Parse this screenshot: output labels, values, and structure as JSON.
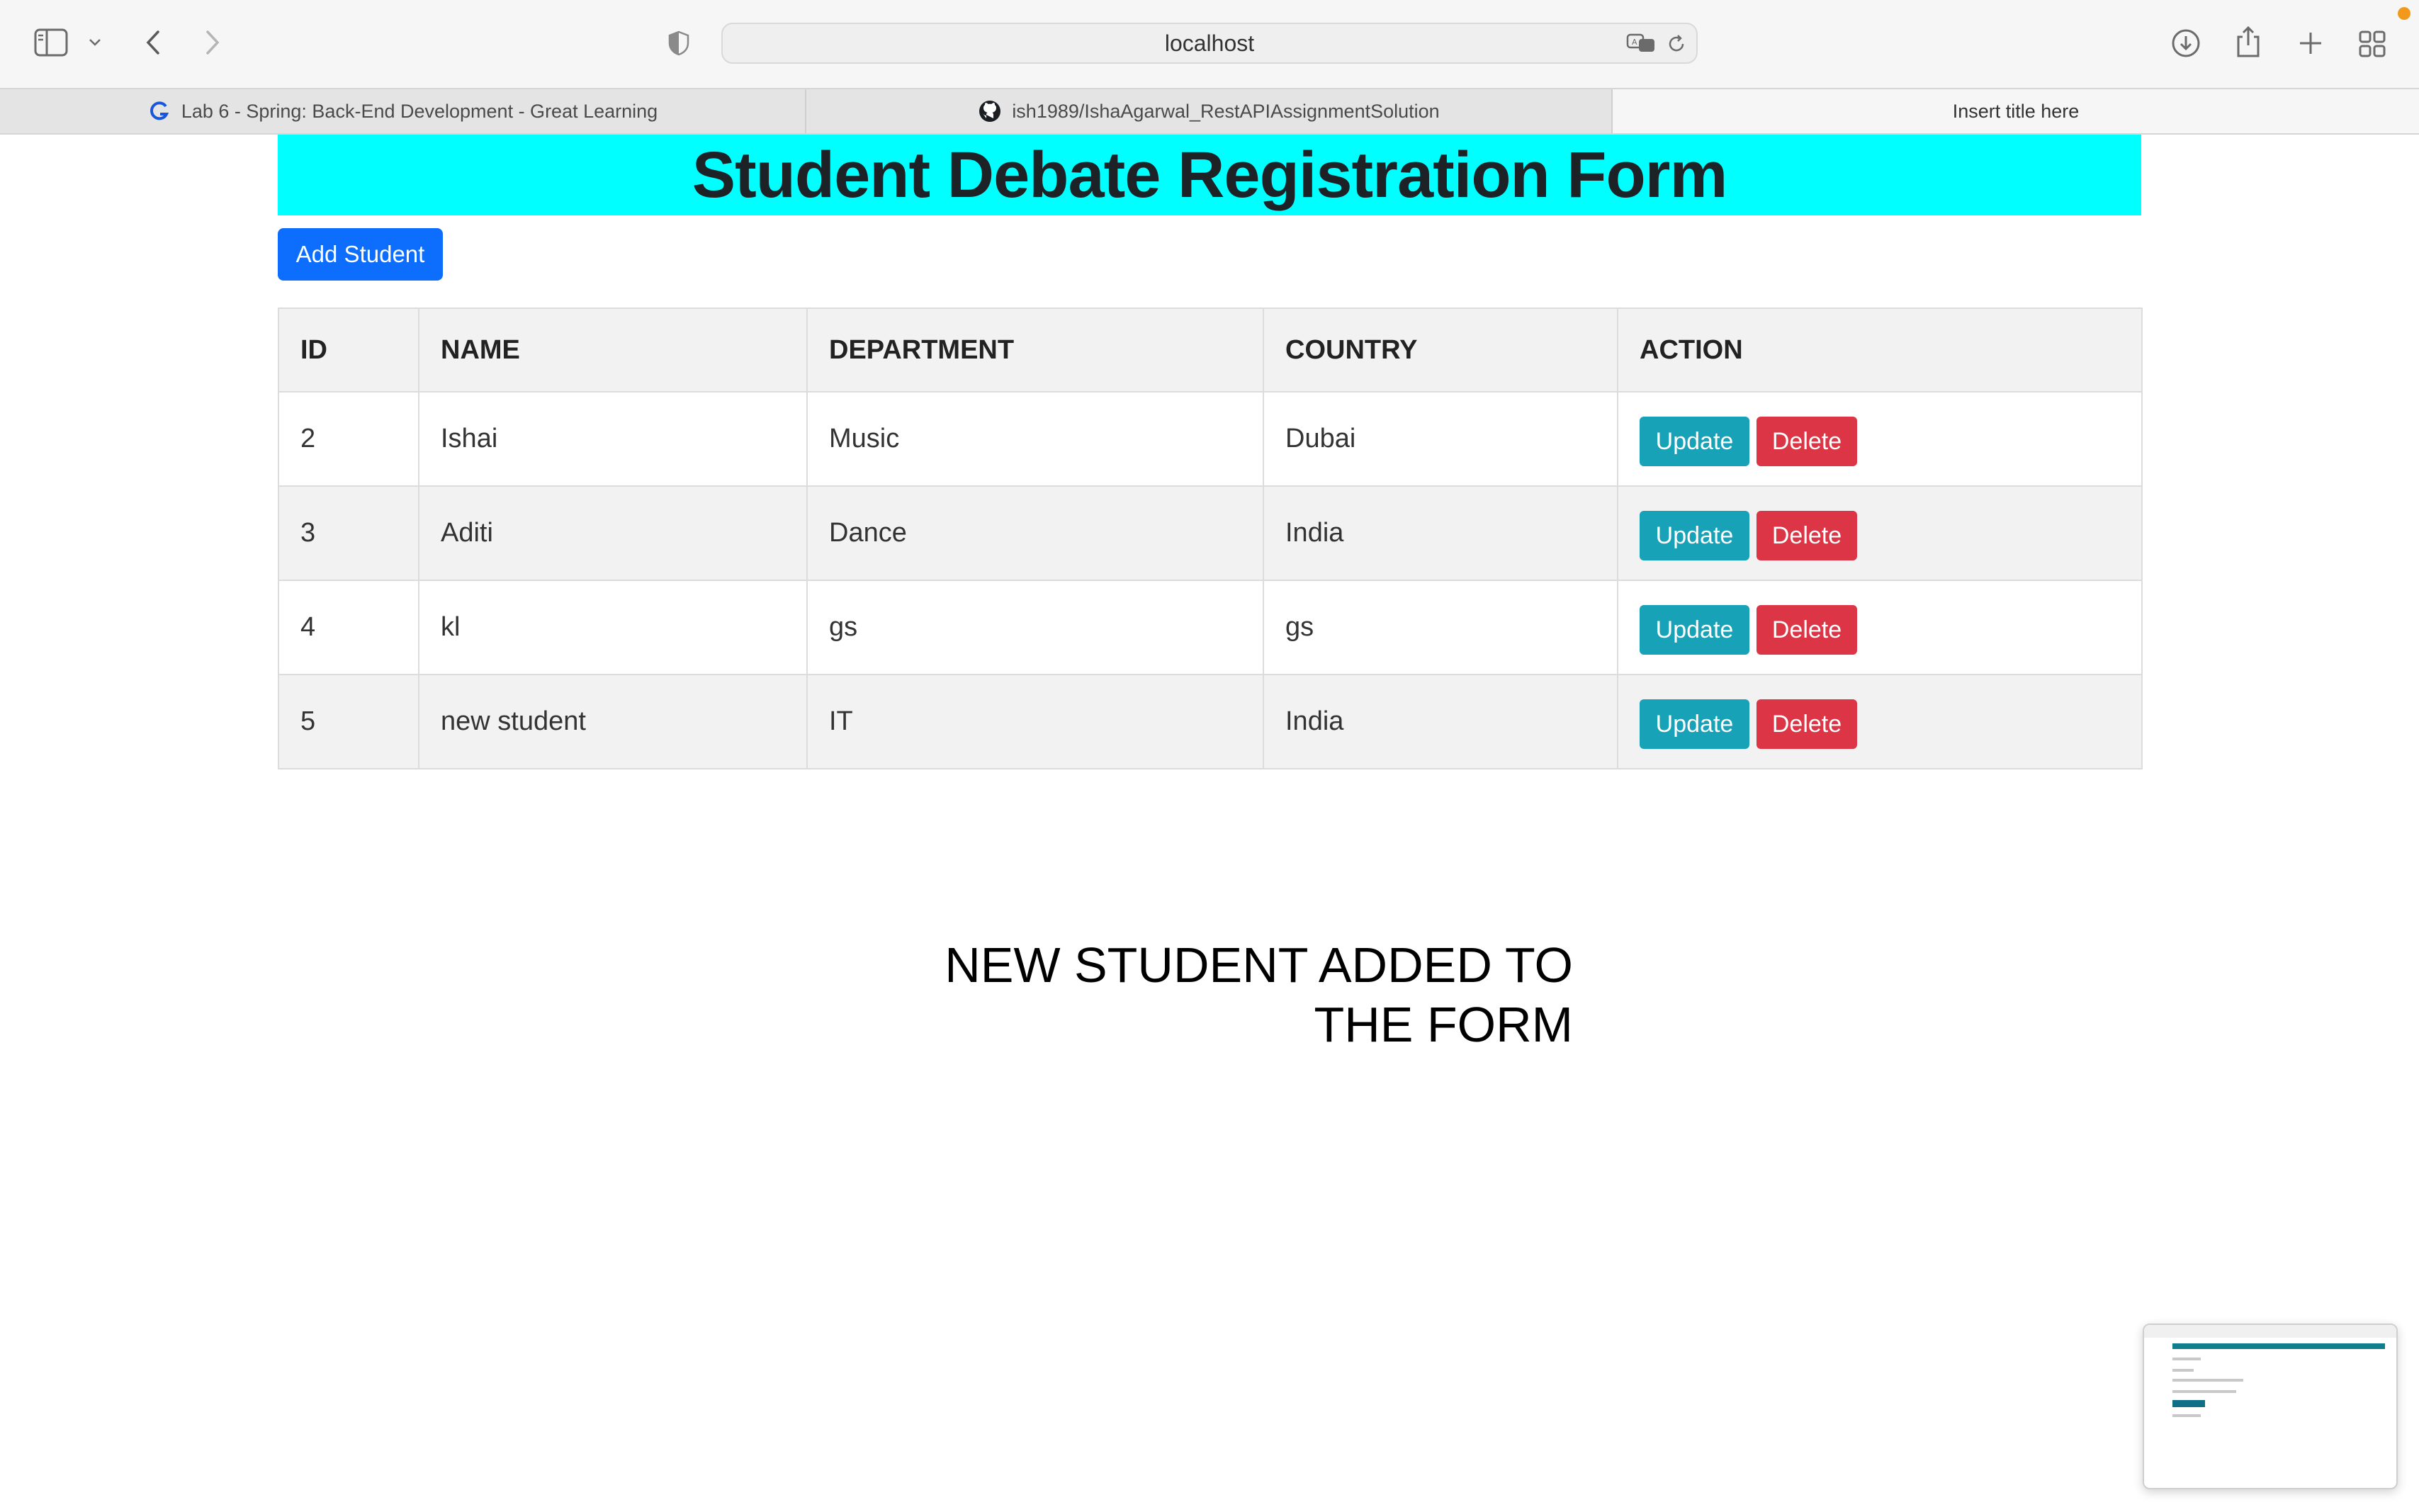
{
  "browser": {
    "url": "localhost",
    "tabs": [
      {
        "label": "Lab 6 - Spring: Back-End Development - Great Learning",
        "favicon": "great-learning-icon"
      },
      {
        "label": "ish1989/IshaAgarwal_RestAPIAssignmentSolution",
        "favicon": "github-icon"
      },
      {
        "label": "Insert title here",
        "active": true
      }
    ]
  },
  "page": {
    "title": "Student Debate Registration Form",
    "add_button": "Add Student",
    "table": {
      "columns": [
        "ID",
        "NAME",
        "DEPARTMENT",
        "COUNTRY",
        "ACTION"
      ],
      "rows": [
        {
          "id": "2",
          "name": "Ishai",
          "department": "Music",
          "country": "Dubai"
        },
        {
          "id": "3",
          "name": "Aditi",
          "department": "Dance",
          "country": "India"
        },
        {
          "id": "4",
          "name": "kl",
          "department": "gs",
          "country": "gs"
        },
        {
          "id": "5",
          "name": "new student",
          "department": "IT",
          "country": "India"
        }
      ],
      "update_label": "Update",
      "delete_label": "Delete"
    },
    "caption_line1": "NEW STUDENT ADDED TO",
    "caption_line2": "THE FORM"
  },
  "colors": {
    "header_band": "#00ffff",
    "primary": "#0d6efd",
    "update": "#17a2b8",
    "delete": "#dc3545"
  }
}
